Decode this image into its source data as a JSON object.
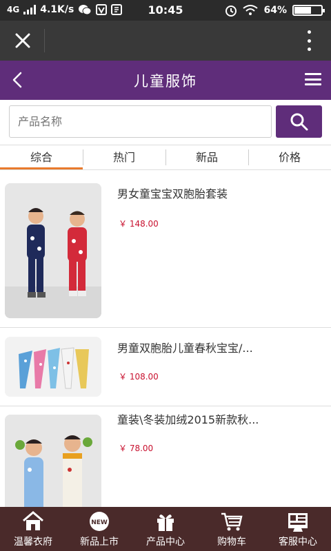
{
  "status_bar": {
    "network": "4G",
    "speed": "4.1K/s",
    "time": "10:45",
    "battery": "64%",
    "battery_level": 0.64,
    "wechat_icon": "wechat-icon",
    "v_icon": "v-app-icon",
    "screenshot_icon": "screenshot-icon",
    "alarm_icon": "alarm-icon",
    "wifi_icon": "wifi-icon"
  },
  "browser_bar": {
    "close_icon": "close-icon",
    "more_icon": "more-vertical-icon"
  },
  "header": {
    "title": "儿童服饰",
    "back_icon": "chevron-left-icon",
    "menu_icon": "hamburger-menu-icon"
  },
  "search": {
    "placeholder": "产品名称",
    "value": "",
    "button_icon": "search-icon"
  },
  "tabs": [
    {
      "label": "综合",
      "active": true
    },
    {
      "label": "热门",
      "active": false
    },
    {
      "label": "新品",
      "active": false
    },
    {
      "label": "价格",
      "active": false
    }
  ],
  "products": [
    {
      "name": "男女童宝宝双胞胎套装",
      "price": "￥ 148.00"
    },
    {
      "name": "男童双胞胎儿童春秋宝宝/...",
      "price": "￥ 108.00"
    },
    {
      "name": "童装\\冬装加绒2015新款秋...",
      "price": "￥ 78.00"
    }
  ],
  "bottom_nav": [
    {
      "label": "温馨衣府",
      "icon": "home-icon"
    },
    {
      "label": "新品上市",
      "icon": "new-badge-icon",
      "badge_text": "NEW"
    },
    {
      "label": "产品中心",
      "icon": "gift-icon"
    },
    {
      "label": "购物车",
      "icon": "cart-icon"
    },
    {
      "label": "客服中心",
      "icon": "customer-service-icon"
    }
  ],
  "colors": {
    "brand": "#5f2d7a",
    "status_bar": "#2b2b2b",
    "browser_bar": "#393939",
    "bottom_nav": "#4a2a2a",
    "price": "#c8102e",
    "active_tab": "#e87a2c"
  }
}
